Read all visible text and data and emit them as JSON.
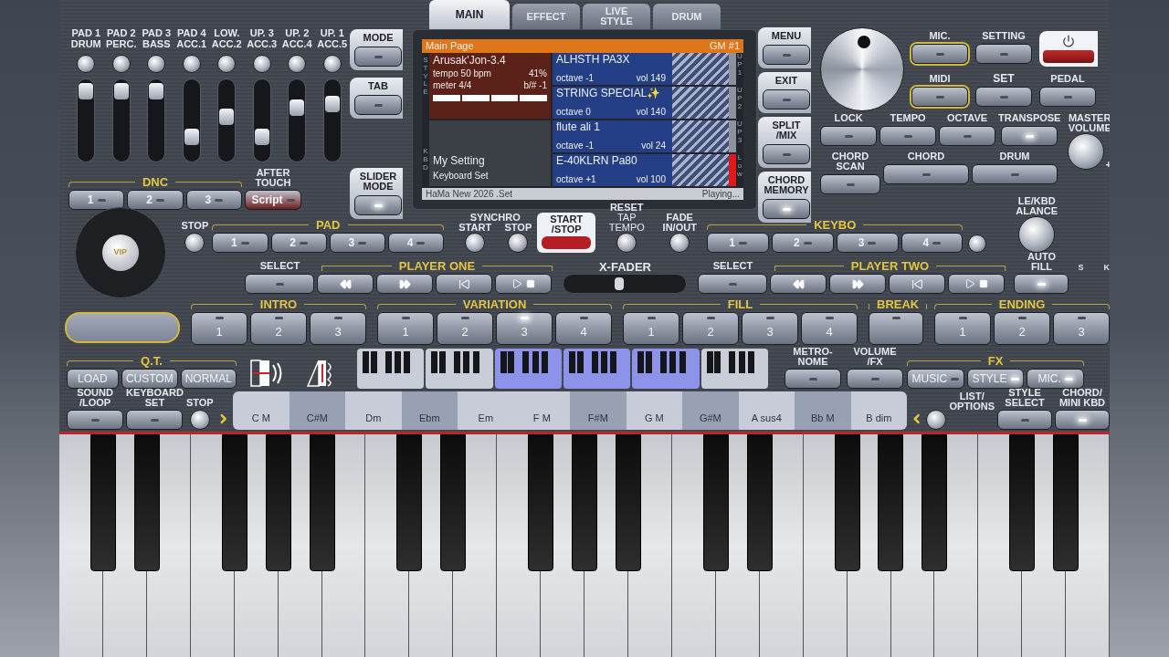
{
  "mixer": {
    "channels": [
      {
        "top": "PAD 1",
        "bottom": "DRUM",
        "level": 0.95
      },
      {
        "top": "PAD 2",
        "bottom": "PERC.",
        "level": 0.95
      },
      {
        "top": "PAD 3",
        "bottom": "BASS",
        "level": 0.95
      },
      {
        "top": "PAD 4",
        "bottom": "ACC.1",
        "level": 0.25
      },
      {
        "top": "LOW.",
        "bottom": "ACC.2",
        "level": 0.55
      },
      {
        "top": "UP. 3",
        "bottom": "ACC.3",
        "level": 0.25
      },
      {
        "top": "UP. 2",
        "bottom": "ACC.4",
        "level": 0.7
      },
      {
        "top": "UP. 1",
        "bottom": "ACC.5",
        "level": 0.75
      }
    ]
  },
  "left_buttons": [
    {
      "label": "MODE",
      "lit": false
    },
    {
      "label": "TAB",
      "lit": false
    },
    {
      "label": "SLIDER\nMODE",
      "lit": true
    }
  ],
  "dnc": {
    "title": "DNC",
    "buttons": [
      "1",
      "2",
      "3"
    ]
  },
  "after_touch": {
    "label": "AFTER\nTOUCH",
    "button": "Script"
  },
  "tabs": [
    {
      "label": "MAIN",
      "selected": true
    },
    {
      "label": "EFFECT",
      "selected": false
    },
    {
      "label": "LIVE\nSTYLE",
      "selected": false
    },
    {
      "label": "DRUM",
      "selected": false
    }
  ],
  "display": {
    "title": "Main Page",
    "badge": "GM #1",
    "style_side": "STYLE",
    "kbd_side": "KBD",
    "style": {
      "name": "Arusak'Jon-3.4",
      "tempo": "tempo 50 bpm",
      "percent": "41%",
      "meter": "meter 4/4",
      "key": "b/# -1"
    },
    "kbd": {
      "name": "My Setting",
      "label": "Keyboard Set"
    },
    "parts": [
      {
        "name": "ALHSTH PA3X",
        "octave": "octave -1",
        "vol": "vol 149",
        "side": "UP1",
        "on": false
      },
      {
        "name": "STRING SPECIAL✨",
        "octave": "octave  0",
        "vol": "vol 140",
        "side": "UP2",
        "on": false
      },
      {
        "name": "flute ali 1",
        "octave": "octave -1",
        "vol": "vol 24",
        "side": "UP3",
        "on": false
      },
      {
        "name": "E-40KLRN Pa80",
        "octave": "octave +1",
        "vol": "vol 100",
        "side": "Low",
        "on": true
      }
    ],
    "footer": "HaMa New 2026 .Set",
    "status": "Playing..."
  },
  "right_buttons": [
    {
      "label": "MENU",
      "lit": false
    },
    {
      "label": "EXIT",
      "lit": false
    },
    {
      "label": "SPLIT\n/MIX",
      "lit": false
    },
    {
      "label": "CHORD\nMEMORY",
      "lit": true
    }
  ],
  "top_controls": [
    [
      {
        "label": "MIC.",
        "kind": "outlined"
      },
      {
        "label": "SETTING",
        "kind": "plain"
      },
      {
        "kind": "power"
      }
    ],
    [
      {
        "label": "MIDI",
        "kind": "outlined"
      },
      {
        "label": "SET",
        "kind": "highlight"
      },
      {
        "label": "PEDAL",
        "kind": "plain"
      }
    ]
  ],
  "lock_row": [
    {
      "label": "LOCK",
      "lit": false
    },
    {
      "label": "TEMPO",
      "lit": false
    },
    {
      "label": "OCTAVE",
      "lit": false
    },
    {
      "label": "TRANSPOSE",
      "lit": true
    }
  ],
  "scan_row": [
    "CHORD SCAN",
    "CHORD",
    "DRUM"
  ],
  "master_volume": {
    "label": "MASTER\nVOLUME",
    "mark": "+"
  },
  "balance": {
    "label": "LE/KBD\nALANCE",
    "left": "S",
    "right": "K"
  },
  "jog_wheel": {
    "logo": "VIP"
  },
  "pad": {
    "stop": "STOP",
    "title": "PAD",
    "buttons": [
      "1",
      "2",
      "3",
      "4"
    ]
  },
  "synchro": {
    "title": "SYNCHRO",
    "start": "START",
    "stop": "STOP"
  },
  "start_stop": {
    "label": "START\n/STOP",
    "on": true
  },
  "reset": {
    "label": "RESET",
    "sub": "TAP TEMPO"
  },
  "fade": {
    "label": "FADE\nIN/OUT"
  },
  "keyboard": {
    "title": "KEYBO",
    "buttons": [
      "1",
      "2",
      "3",
      "4"
    ]
  },
  "auto_fill": {
    "label": "AUTO\nFILL",
    "lit": true
  },
  "players": [
    {
      "select": "SELECT",
      "title": "PLAYER ONE"
    },
    {
      "select": "SELECT",
      "title": "PLAYER TWO"
    }
  ],
  "x_fader": {
    "label": "X-FADER",
    "level": 0.45
  },
  "sections": [
    {
      "title": "INTRO",
      "buttons": [
        {
          "label": "1",
          "lit": false
        },
        {
          "label": "2",
          "lit": false
        },
        {
          "label": "3",
          "lit": false
        }
      ]
    },
    {
      "title": "VARIATION",
      "buttons": [
        {
          "label": "1",
          "lit": false
        },
        {
          "label": "2",
          "lit": false
        },
        {
          "label": "3",
          "lit": true
        },
        {
          "label": "4",
          "lit": false
        }
      ]
    },
    {
      "title": "FILL",
      "buttons": [
        {
          "label": "1",
          "lit": false
        },
        {
          "label": "2",
          "lit": false
        },
        {
          "label": "3",
          "lit": false
        },
        {
          "label": "4",
          "lit": false
        }
      ]
    },
    {
      "title": "BREAK",
      "buttons": [
        {
          "lit": false
        }
      ]
    },
    {
      "title": "ENDING",
      "buttons": [
        {
          "label": "1",
          "lit": false
        },
        {
          "label": "2",
          "lit": false
        },
        {
          "label": "3",
          "lit": false
        }
      ]
    }
  ],
  "qt": {
    "title": "Q.T.",
    "buttons": [
      "LOAD",
      "CUSTOM",
      "NORMAL"
    ]
  },
  "mini_keyboard": {
    "octaves": [
      {
        "selected": false
      },
      {
        "selected": false
      },
      {
        "selected": true
      },
      {
        "selected": true
      },
      {
        "selected": true
      },
      {
        "selected": false
      }
    ]
  },
  "metronome": {
    "label": "METRO-\nNOME"
  },
  "volume_fx": {
    "label": "VOLUME\n/FX"
  },
  "fx": {
    "title": "FX",
    "buttons": [
      {
        "label": "MUSIC",
        "lit": false
      },
      {
        "label": "STYLE",
        "lit": true
      },
      {
        "label": "MIC.",
        "lit": true
      }
    ]
  },
  "sound_loop": {
    "label": "SOUND\n/LOOP"
  },
  "keyboard_set": {
    "label": "KEYBOARD\nSET"
  },
  "chord_stop": {
    "label": "STOP"
  },
  "chords": [
    {
      "label": "C M",
      "kind": "natural"
    },
    {
      "label": "C#M",
      "kind": "sharp"
    },
    {
      "label": "Dm",
      "kind": "natural"
    },
    {
      "label": "Ebm",
      "kind": "sharp"
    },
    {
      "label": "Em",
      "kind": "natural"
    },
    {
      "label": "F M",
      "kind": "natural"
    },
    {
      "label": "F#M",
      "kind": "sharp"
    },
    {
      "label": "G M",
      "kind": "natural"
    },
    {
      "label": "G#M",
      "kind": "sharp"
    },
    {
      "label": "A sus4",
      "kind": "natural"
    },
    {
      "label": "Bb M",
      "kind": "sharp"
    },
    {
      "label": "B dim",
      "kind": "natural"
    }
  ],
  "list_options": {
    "label": "LIST/\nOPTIONS"
  },
  "style_select": {
    "label": "STYLE\nSELECT"
  },
  "chord_mini_kbd": {
    "label": "CHORD/\nMINI KBD",
    "lit": true
  }
}
